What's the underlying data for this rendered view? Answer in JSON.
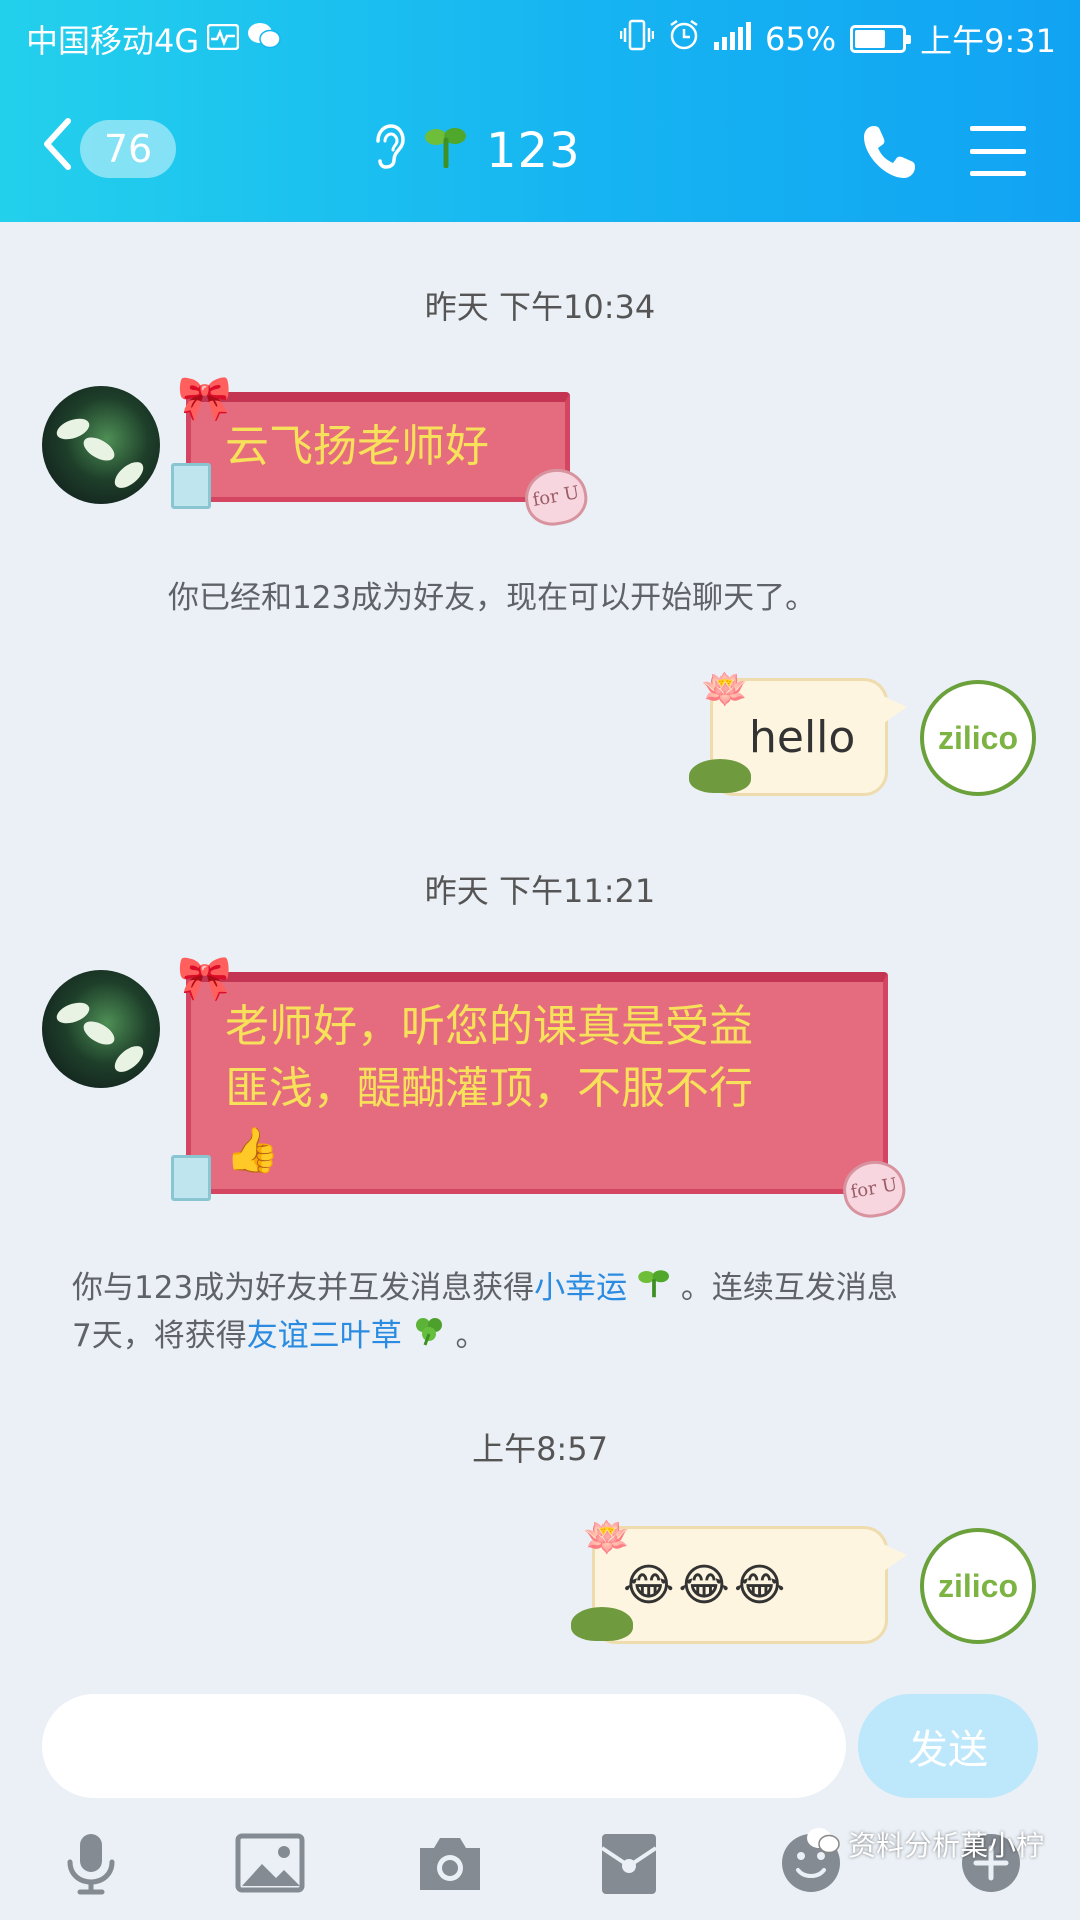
{
  "status_bar": {
    "carrier": "中国移动4G",
    "battery_percent": "65%",
    "battery_level": 0.65,
    "network": "4G",
    "time": "上午9:31"
  },
  "title_bar": {
    "back_icon": "chevron-left-icon",
    "unread_count": "76",
    "title": "123",
    "icons": [
      "ear-icon",
      "sprout-icon",
      "phone-icon",
      "menu-icon"
    ]
  },
  "chat": {
    "timestamp_1": "昨天 下午10:34",
    "msg_1": "云飞扬老师好",
    "bubble_badge": "for U",
    "system_1": "你已经和123成为好友，现在可以开始聊天了。",
    "msg_2": "hello",
    "my_avatar_text": "zilico",
    "timestamp_2": "昨天 下午11:21",
    "msg_3_line1": "老师好，听您的课真是受益",
    "msg_3_line2": "匪浅，醍醐灌顶，不服不行",
    "msg_3_emoji": "👍",
    "system_2_part1": "你与123成为好友并互发消息获得",
    "system_2_link1": "小幸运",
    "system_2_part2": "。连续互发消息",
    "system_2_part3": "7天，将获得",
    "system_2_link2": "友谊三叶草",
    "system_2_part4": "。",
    "timestamp_3": "上午8:57",
    "msg_4": "😂😂😂"
  },
  "input_bar": {
    "placeholder": "",
    "send_label": "发送"
  },
  "toolbar": {
    "items": [
      "microphone-icon",
      "image-icon",
      "camera-icon",
      "red-packet-icon",
      "emoji-icon",
      "plus-icon"
    ]
  },
  "watermark": {
    "text": "资料分析菓小柠"
  },
  "colors": {
    "header_start": "#23d0ec",
    "header_end": "#11a3f3",
    "background": "#eaf0f6",
    "gift_bubble": "#e56b7e",
    "gift_text": "#f7e05a",
    "lotus_bubble": "#fdf5df",
    "link": "#2b8be0",
    "send_button": "#bde7fb"
  }
}
